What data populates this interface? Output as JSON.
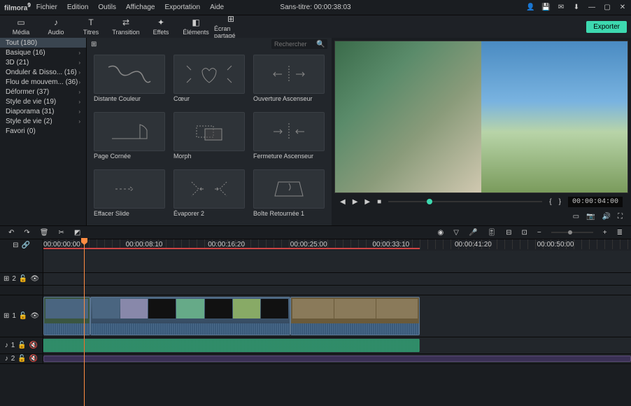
{
  "app": {
    "name": "filmora",
    "version": "9"
  },
  "menu": [
    "Fichier",
    "Edition",
    "Outils",
    "Affichage",
    "Exportation",
    "Aide"
  ],
  "title": "Sans-titre:  00:00:38:03",
  "export": "Exporter",
  "tabs": [
    {
      "icon": "▭",
      "label": "Média"
    },
    {
      "icon": "♪",
      "label": "Audio"
    },
    {
      "icon": "T",
      "label": "Titres"
    },
    {
      "icon": "⇄",
      "label": "Transition"
    },
    {
      "icon": "✦",
      "label": "Effets"
    },
    {
      "icon": "◧",
      "label": "Éléments"
    },
    {
      "icon": "⊞",
      "label": "Écran partagé"
    }
  ],
  "activeTab": 3,
  "categories": [
    {
      "label": "Tout (180)",
      "active": true
    },
    {
      "label": "Basique (16)"
    },
    {
      "label": "3D (21)"
    },
    {
      "label": "Onduler & Disso...  (16)"
    },
    {
      "label": "Flou de mouvem...  (36)"
    },
    {
      "label": "Déformer (37)"
    },
    {
      "label": "Style de vie (19)"
    },
    {
      "label": "Diaporama (31)"
    },
    {
      "label": "Style de vie (2)"
    },
    {
      "label": "Favori (0)"
    }
  ],
  "search": {
    "placeholder": "Rechercher"
  },
  "transitions": [
    "Distante Couleur",
    "Cœur",
    "Ouverture Ascenseur",
    "Page Cornée",
    "Morph",
    "Fermeture Ascenseur",
    "Effacer Slide",
    "Évaporer 2",
    "Boîte Retournée 1"
  ],
  "timecode": "00:00:04:00",
  "ruler": [
    "00:00:00:00",
    "00:00:08:10",
    "00:00:16:20",
    "00:00:25:00",
    "00:00:33:10",
    "00:00:41:20",
    "00:00:50:00"
  ],
  "tracks": {
    "v2": "2",
    "v1": "1",
    "a1": "1",
    "a2": "2"
  },
  "trackIcons": {
    "link": "🔗",
    "lock": "🔒",
    "eye": "👁",
    "mute": "🔇",
    "vid": "⊞",
    "aud": "♪"
  }
}
